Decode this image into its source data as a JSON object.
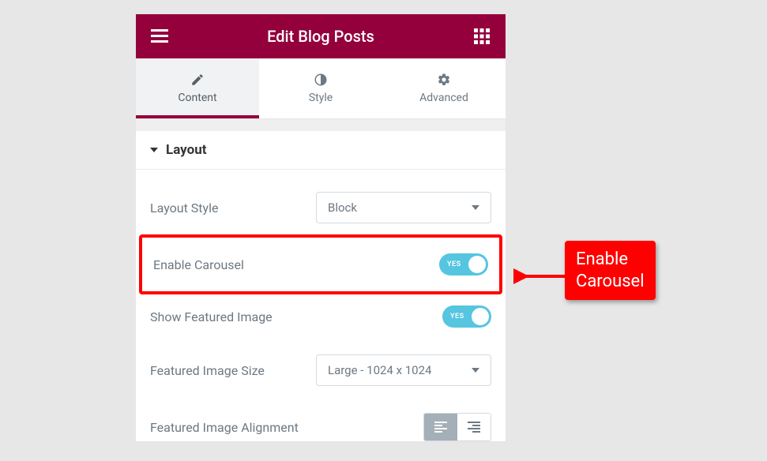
{
  "header": {
    "title": "Edit Blog Posts"
  },
  "tabs": {
    "content": "Content",
    "style": "Style",
    "advanced": "Advanced"
  },
  "section": {
    "title": "Layout"
  },
  "controls": {
    "layout_style": {
      "label": "Layout Style",
      "value": "Block"
    },
    "enable_carousel": {
      "label": "Enable Carousel",
      "toggle_text": "YES"
    },
    "show_featured_image": {
      "label": "Show Featured Image",
      "toggle_text": "YES"
    },
    "featured_image_size": {
      "label": "Featured Image Size",
      "value": "Large - 1024 x 1024"
    },
    "featured_image_alignment": {
      "label": "Featured Image Alignment"
    }
  },
  "callout": {
    "line1": "Enable",
    "line2": "Carousel"
  }
}
